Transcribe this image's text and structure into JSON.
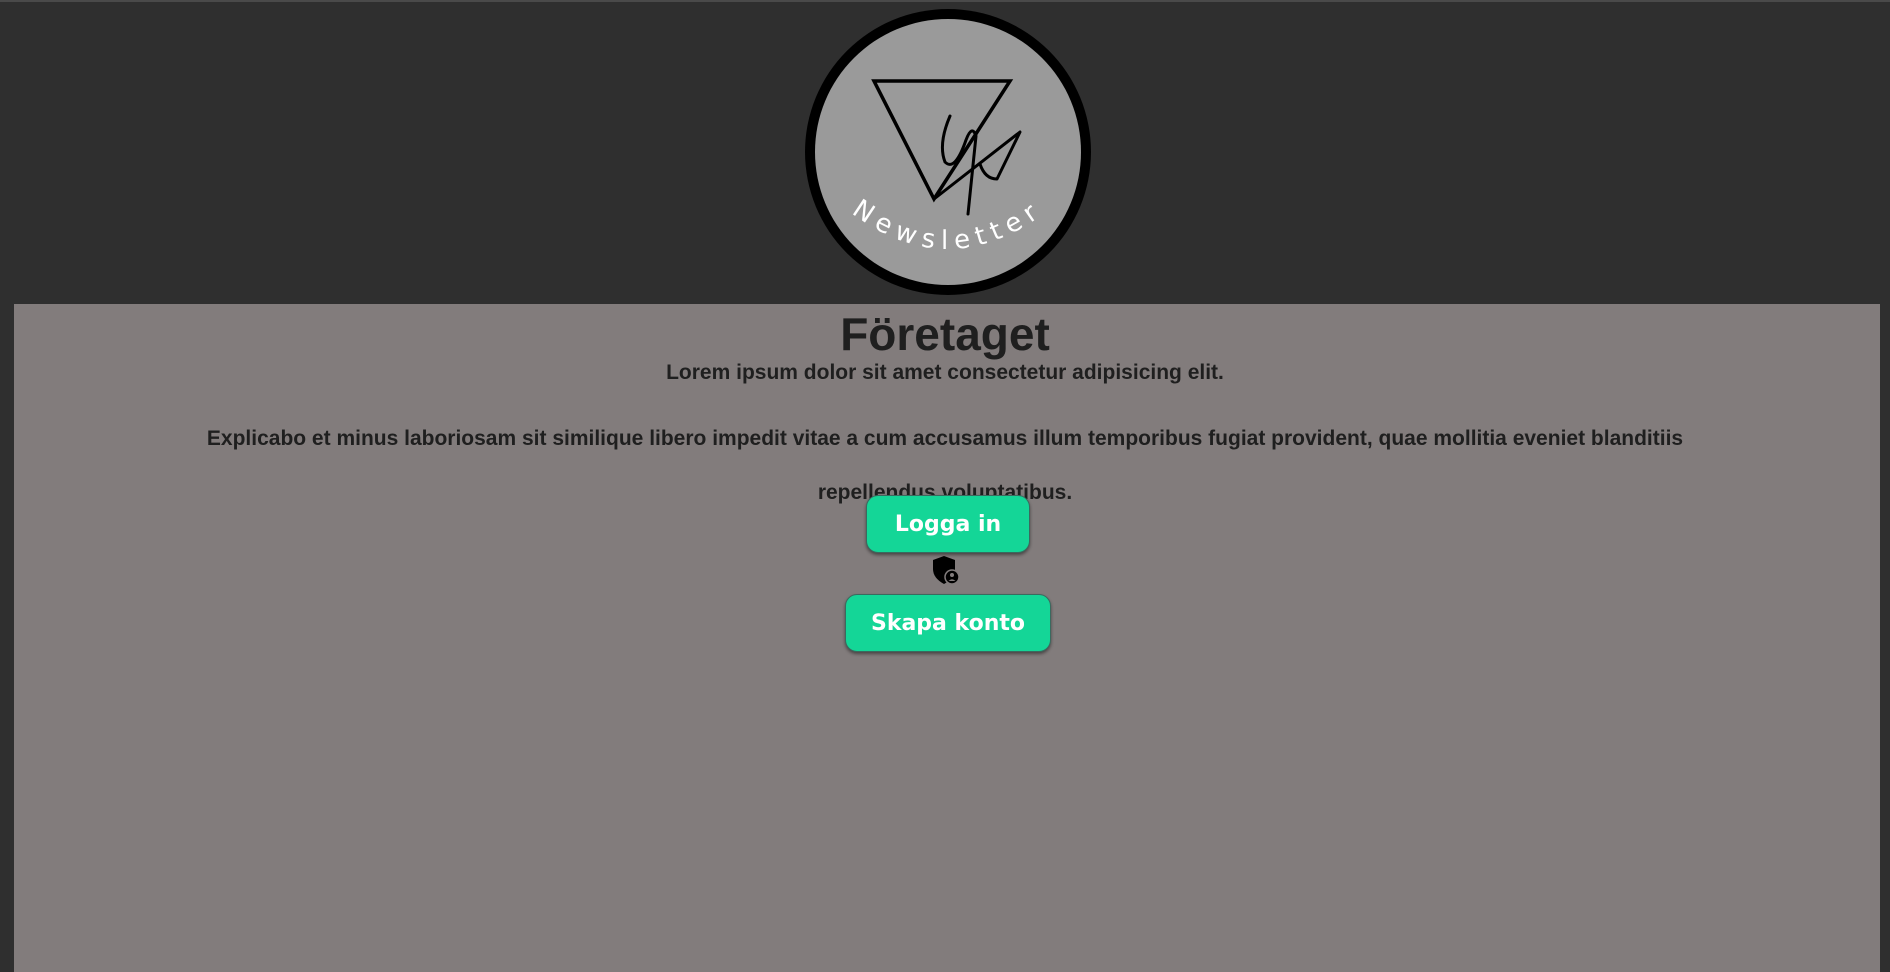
{
  "logo": {
    "text": "Newsletter",
    "icon": "triangle-signature-logo"
  },
  "main": {
    "title": "Företaget",
    "lead": "Lorem ipsum dolor sit amet consectetur adipisicing elit.",
    "body": "Explicabo et minus laboriosam sit similique libero impedit vitae a cum accusamus illum temporibus fugiat provident, quae mollitia eveniet blanditiis repellendus voluptatibus."
  },
  "actions": {
    "login_label": "Logga in",
    "signup_label": "Skapa konto",
    "separator_icon": "shield-user-icon"
  },
  "colors": {
    "page_background": "#2f2f2f",
    "panel_background": "#827c7c",
    "button": "#14d697",
    "button_text": "#ffffff",
    "logo_fill": "#9a9a9a",
    "logo_ring": "#000000"
  }
}
